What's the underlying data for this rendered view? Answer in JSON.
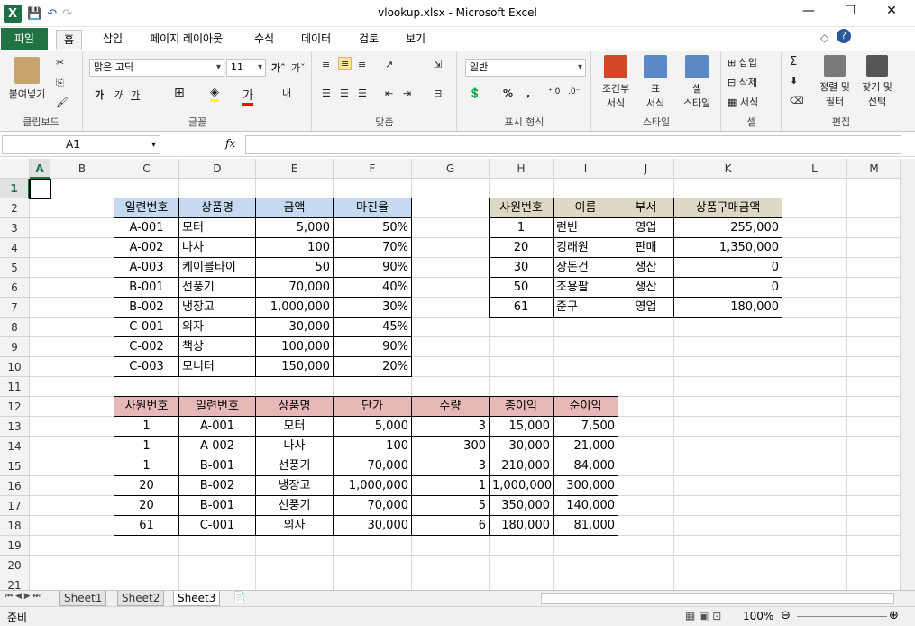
{
  "window": {
    "title": "vlookup.xlsx - Microsoft Excel"
  },
  "qat": {
    "logo": "X",
    "save": "💾",
    "undo": "↶",
    "redo": "↷"
  },
  "tabs": [
    "파일",
    "홈",
    "삽입",
    "페이지 레이아웃",
    "수식",
    "데이터",
    "검토",
    "보기"
  ],
  "ribbon": {
    "clipboard": {
      "label": "클립보드",
      "paste": "붙여넣기"
    },
    "font": {
      "label": "글꼴",
      "name": "맑은 고딕",
      "size": "11",
      "bold": "가",
      "italic": "가",
      "underline": "가"
    },
    "align": {
      "label": "맞춤"
    },
    "number": {
      "label": "표시 형식",
      "format": "일반",
      "percent": "%",
      "comma": ","
    },
    "styles": {
      "label": "스타일",
      "cond": "조건부\n서식",
      "table": "표\n서식",
      "cell": "셀\n스타일"
    },
    "cells": {
      "label": "셀",
      "insert": "삽입",
      "delete": "삭제",
      "format": "서식"
    },
    "edit": {
      "label": "편집",
      "sort": "정렬 및\n필터",
      "find": "찾기 및\n선택"
    }
  },
  "formula": {
    "namebox": "A1",
    "fx": "fx",
    "value": ""
  },
  "columns": [
    "A",
    "B",
    "C",
    "D",
    "E",
    "F",
    "G",
    "H",
    "I",
    "J",
    "K",
    "L",
    "M"
  ],
  "rows": [
    "1",
    "2",
    "3",
    "4",
    "5",
    "6",
    "7",
    "8",
    "9",
    "10",
    "11",
    "12",
    "13",
    "14",
    "15",
    "16",
    "17",
    "18",
    "19",
    "20",
    "21"
  ],
  "table1": {
    "headers": [
      "일련번호",
      "상품명",
      "금액",
      "마진율"
    ],
    "rows": [
      [
        "A-001",
        "모터",
        "5,000",
        "50%"
      ],
      [
        "A-002",
        "나사",
        "100",
        "70%"
      ],
      [
        "A-003",
        "케이블타이",
        "50",
        "90%"
      ],
      [
        "B-001",
        "선풍기",
        "70,000",
        "40%"
      ],
      [
        "B-002",
        "냉장고",
        "1,000,000",
        "30%"
      ],
      [
        "C-001",
        "의자",
        "30,000",
        "45%"
      ],
      [
        "C-002",
        "책상",
        "100,000",
        "90%"
      ],
      [
        "C-003",
        "모니터",
        "150,000",
        "20%"
      ]
    ]
  },
  "table2": {
    "headers": [
      "사원번호",
      "이름",
      "부서",
      "상품구매금액"
    ],
    "rows": [
      [
        "1",
        "런빈",
        "영업",
        "255,000"
      ],
      [
        "20",
        "킹래원",
        "판매",
        "1,350,000"
      ],
      [
        "30",
        "장돈건",
        "생산",
        "0"
      ],
      [
        "50",
        "조용팔",
        "생산",
        "0"
      ],
      [
        "61",
        "준구",
        "영업",
        "180,000"
      ]
    ]
  },
  "table3": {
    "headers": [
      "사원번호",
      "일련번호",
      "상품명",
      "단가",
      "수량",
      "총이익",
      "순이익"
    ],
    "rows": [
      [
        "1",
        "A-001",
        "모터",
        "5,000",
        "3",
        "15,000",
        "7,500"
      ],
      [
        "1",
        "A-002",
        "나사",
        "100",
        "300",
        "30,000",
        "21,000"
      ],
      [
        "1",
        "B-001",
        "선풍기",
        "70,000",
        "3",
        "210,000",
        "84,000"
      ],
      [
        "20",
        "B-002",
        "냉장고",
        "1,000,000",
        "1",
        "1,000,000",
        "300,000"
      ],
      [
        "20",
        "B-001",
        "선풍기",
        "70,000",
        "5",
        "350,000",
        "140,000"
      ],
      [
        "61",
        "C-001",
        "의자",
        "30,000",
        "6",
        "180,000",
        "81,000"
      ]
    ]
  },
  "colors": {
    "t1header": "#c5d9f1",
    "t2header": "#ddd9c4",
    "t3header": "#e6b8b7",
    "excel": "#217346"
  },
  "sheets": [
    "Sheet1",
    "Sheet2",
    "Sheet3"
  ],
  "status": {
    "ready": "준비",
    "zoom": "100%"
  }
}
